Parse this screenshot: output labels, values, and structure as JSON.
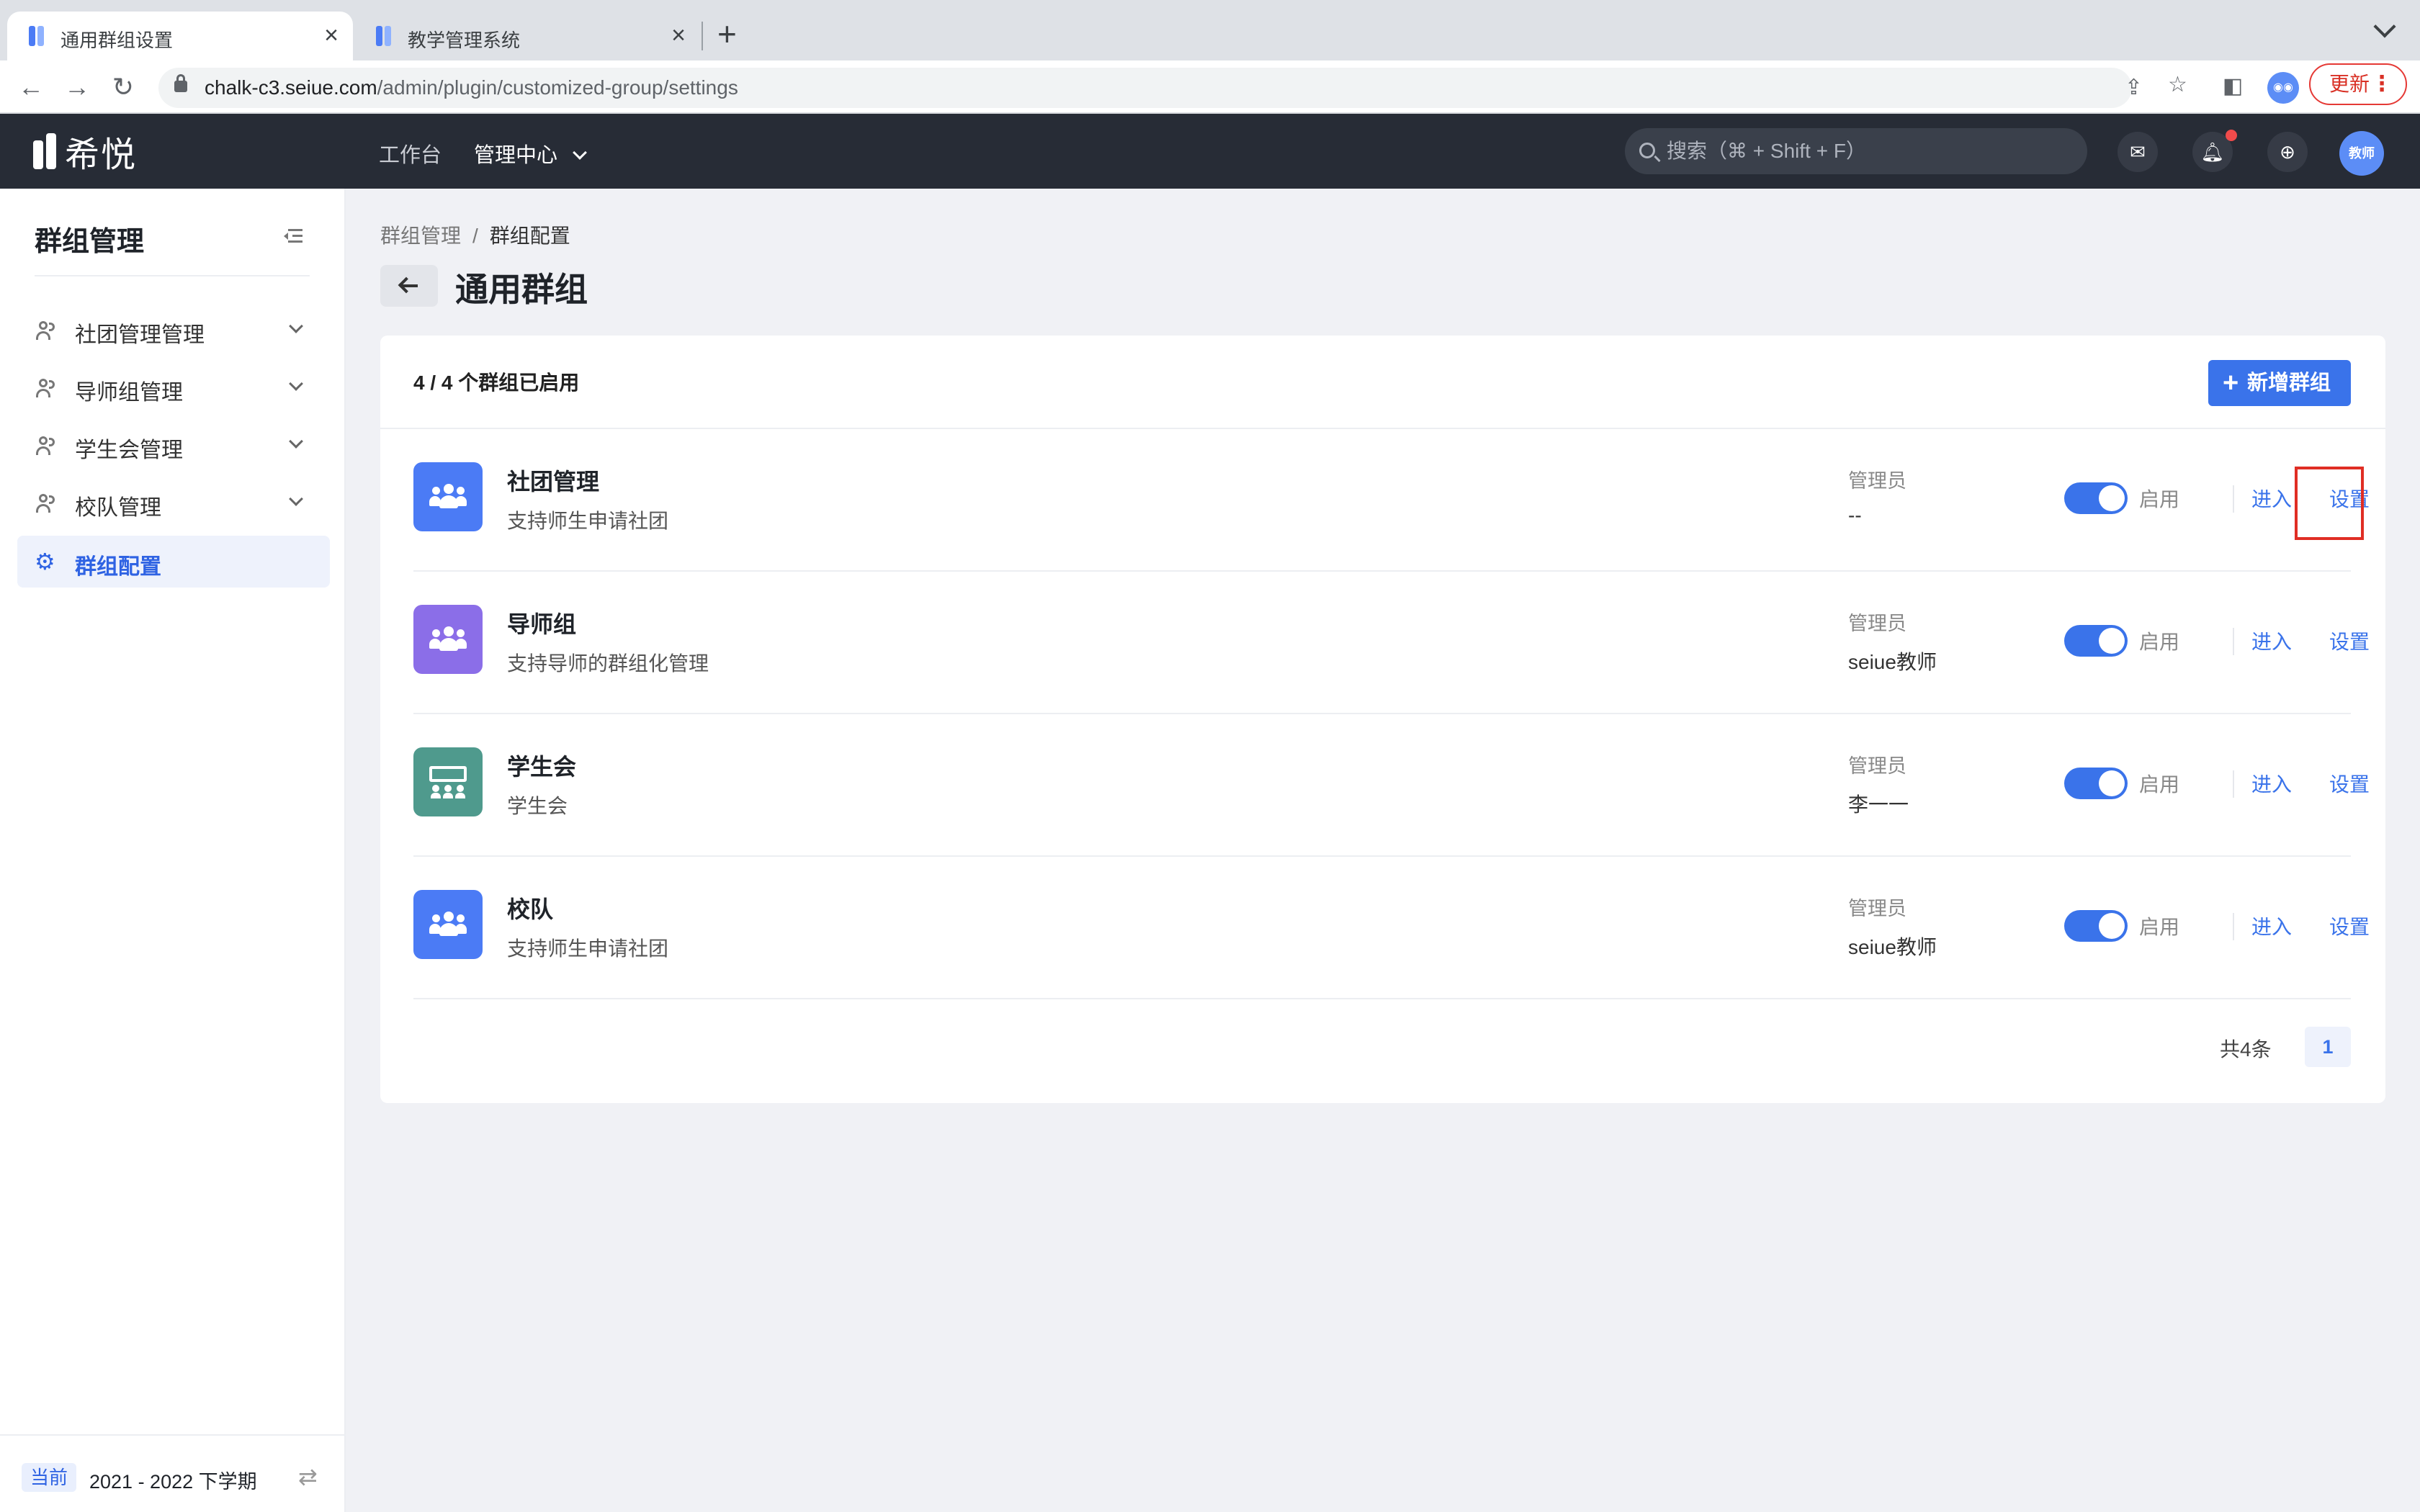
{
  "browser": {
    "tabs": [
      {
        "title": "通用群组设置",
        "active": true
      },
      {
        "title": "教学管理系统",
        "active": false
      }
    ],
    "url_host": "chalk-c3.seiue.com",
    "url_path": "/admin/plugin/customized-group/settings",
    "update_label": "更新"
  },
  "app": {
    "logo_text": "希悦",
    "nav": [
      "工作台",
      "管理中心"
    ],
    "search_placeholder": "搜索（⌘ + Shift + F）",
    "avatar_text": "教师"
  },
  "sidebar": {
    "title": "群组管理",
    "items": [
      {
        "label": "社团管理管理",
        "selected": false
      },
      {
        "label": "导师组管理",
        "selected": false
      },
      {
        "label": "学生会管理",
        "selected": false
      },
      {
        "label": "校队管理",
        "selected": false
      },
      {
        "label": "群组配置",
        "selected": true
      }
    ],
    "footer_tag": "当前",
    "footer_term": "2021 - 2022 下学期"
  },
  "breadcrumb": [
    "群组管理",
    "群组配置"
  ],
  "page_title": "通用群组",
  "card": {
    "count_text": "4 / 4 个群组已启用",
    "add_button": "新增群组",
    "admin_label": "管理员",
    "toggle_label": "启用",
    "enter_label": "进入",
    "settings_label": "设置",
    "groups": [
      {
        "name": "社团管理",
        "desc": "支持师生申请社团",
        "admin": "--",
        "enabled": true,
        "color": "#4b7bf5",
        "icon": "people-icon"
      },
      {
        "name": "导师组",
        "desc": "支持导师的群组化管理",
        "admin": "seiue教师",
        "enabled": true,
        "color": "#8b6ee8",
        "icon": "people-icon"
      },
      {
        "name": "学生会",
        "desc": "学生会",
        "admin": "李一一",
        "enabled": true,
        "color": "#4f9a8d",
        "icon": "classroom-icon"
      },
      {
        "name": "校队",
        "desc": "支持师生申请社团",
        "admin": "seiue教师",
        "enabled": true,
        "color": "#4b7bf5",
        "icon": "people-icon"
      }
    ],
    "pagination": {
      "total_text": "共4条",
      "current_page": "1"
    }
  },
  "colors": {
    "accent": "#3a73ea",
    "highlight": "#e02e24",
    "appbar": "#272c36"
  }
}
